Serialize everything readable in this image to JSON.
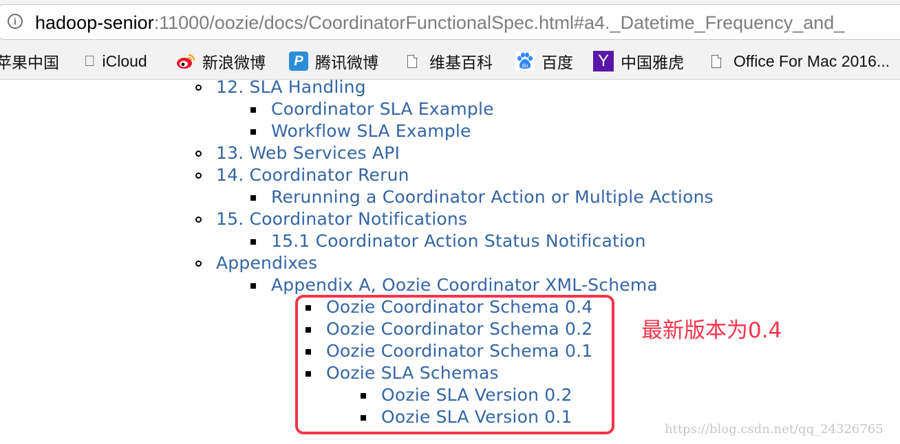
{
  "address_bar": {
    "host": "hadoop-senior",
    "path": ":11000/oozie/docs/CoordinatorFunctionalSpec.html#a4._Datetime_Frequency_and_"
  },
  "bookmarks": [
    {
      "label": "苹果中国",
      "icon": "none"
    },
    {
      "label": "iCloud",
      "icon": "apple-icon"
    },
    {
      "label": "新浪微博",
      "icon": "weibo-icon"
    },
    {
      "label": "腾讯微博",
      "icon": "tencent-weibo-icon"
    },
    {
      "label": "维基百科",
      "icon": "document-icon"
    },
    {
      "label": "百度",
      "icon": "baidu-icon"
    },
    {
      "label": "中国雅虎",
      "icon": "yahoo-icon"
    },
    {
      "label": "Office For Mac 2016...",
      "icon": "document-icon"
    }
  ],
  "toc": [
    {
      "label": "12. SLA Handling",
      "level": 1
    },
    {
      "label": "Coordinator SLA Example",
      "level": 2
    },
    {
      "label": "Workflow SLA Example",
      "level": 2
    },
    {
      "label": "13. Web Services API",
      "level": 1
    },
    {
      "label": "14. Coordinator Rerun",
      "level": 1
    },
    {
      "label": "Rerunning a Coordinator Action or Multiple Actions",
      "level": 2
    },
    {
      "label": "15. Coordinator Notifications",
      "level": 1
    },
    {
      "label": "15.1 Coordinator Action Status Notification",
      "level": 2
    },
    {
      "label": "Appendixes",
      "level": 1
    },
    {
      "label": "Appendix A, Oozie Coordinator XML-Schema",
      "level": 2
    },
    {
      "label": "Oozie Coordinator Schema 0.4",
      "level": 3
    },
    {
      "label": "Oozie Coordinator Schema 0.2",
      "level": 3
    },
    {
      "label": "Oozie Coordinator Schema 0.1",
      "level": 3
    },
    {
      "label": "Oozie SLA Schemas",
      "level": 3
    },
    {
      "label": "Oozie SLA Version 0.2",
      "level": 4
    },
    {
      "label": "Oozie SLA Version 0.1",
      "level": 4
    }
  ],
  "annotation": {
    "text": "最新版本为0.4",
    "color": "#f5344a"
  },
  "watermark": "https://blog.csdn.net/qq_24326765",
  "colors": {
    "link": "#3465a4",
    "highlight": "#f5344a"
  }
}
